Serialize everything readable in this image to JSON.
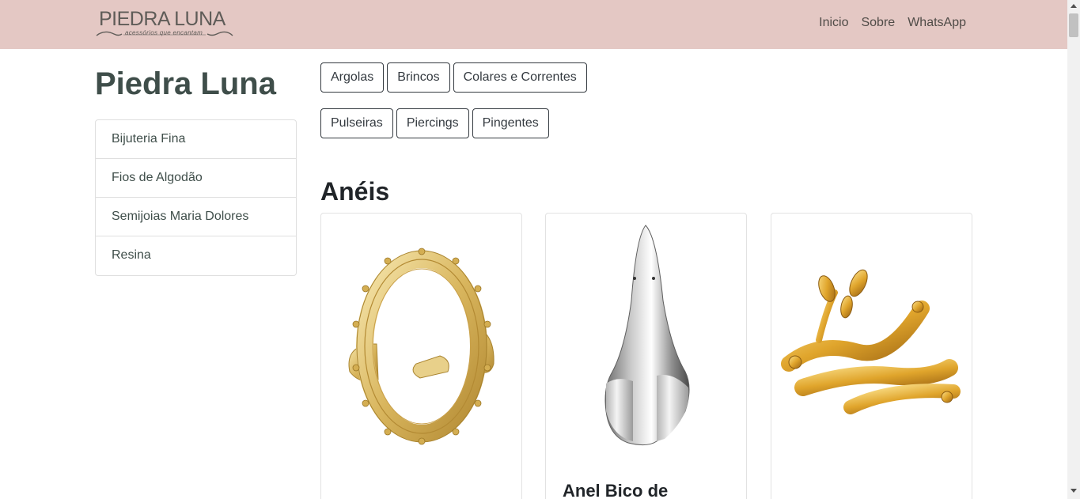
{
  "navbar": {
    "logo_text": "PIEDRA LUNA",
    "logo_tagline": "acessórios que encantam",
    "links": [
      "Inicio",
      "Sobre",
      "WhatsApp"
    ]
  },
  "sidebar": {
    "title": "Piedra Luna",
    "items": [
      "Bijuteria Fina",
      "Fios de Algodão",
      "Semijoias Maria Dolores",
      "Resina"
    ]
  },
  "categories": {
    "row1": [
      "Argolas",
      "Brincos",
      "Colares e Correntes"
    ],
    "row2": [
      "Pulseiras",
      "Piercings",
      "Pingentes"
    ]
  },
  "section": {
    "title": "Anéis"
  },
  "products": [
    {
      "image": "gold-oval-ring",
      "title": ""
    },
    {
      "image": "silver-beak-ring",
      "title": "Anel Bico de"
    },
    {
      "image": "gold-branch-ring",
      "title": ""
    }
  ],
  "colors": {
    "navbar_bg": "#e4c8c4",
    "brand_text": "#3f4e4a",
    "button_border": "#343a40"
  }
}
